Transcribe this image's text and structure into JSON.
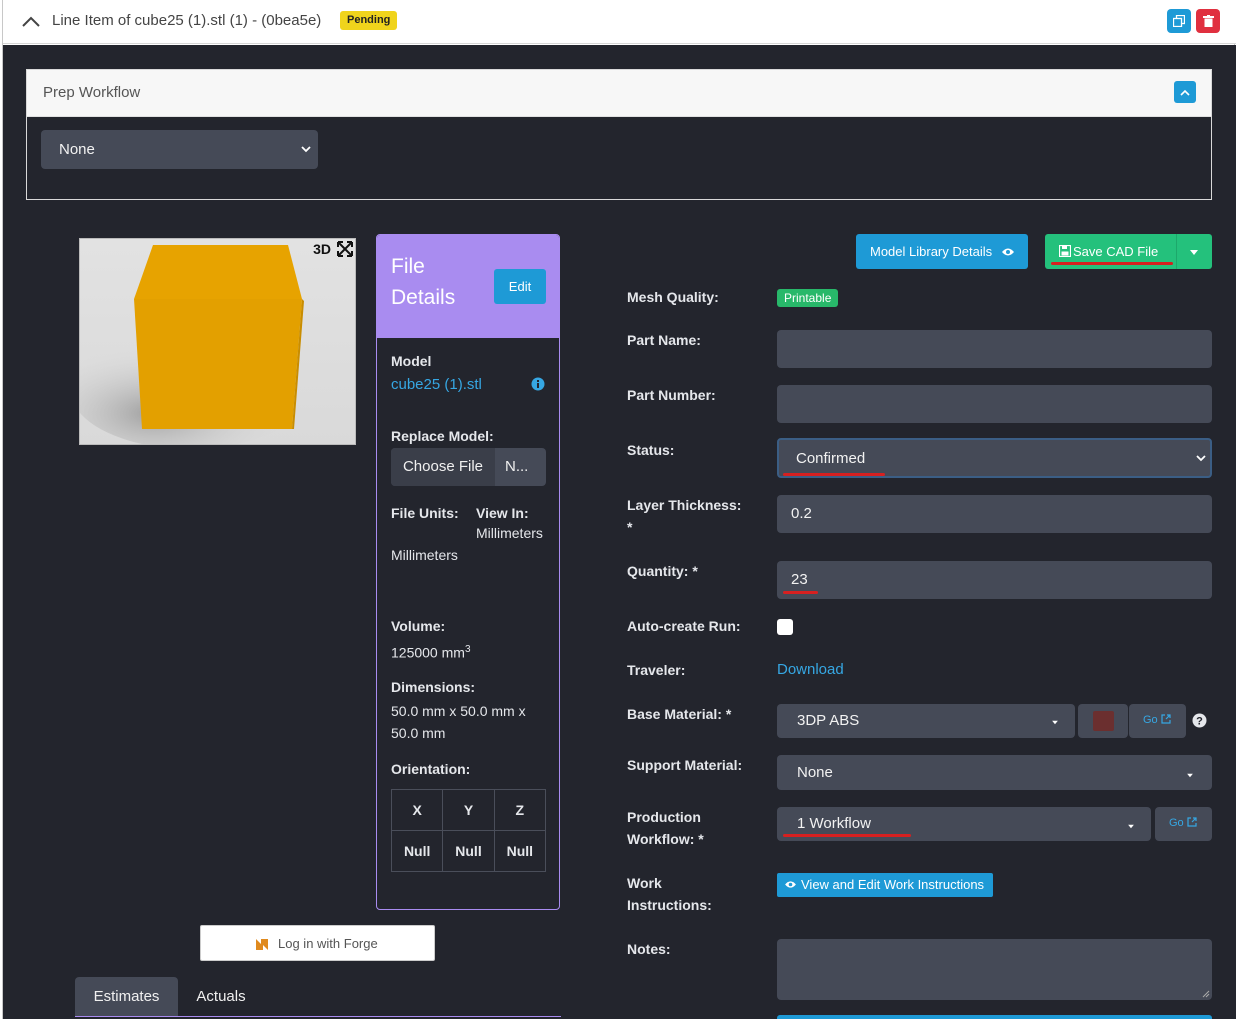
{
  "header": {
    "title": "Line Item of cube25 (1).stl (1) - (0bea5e)",
    "status_badge": "Pending"
  },
  "prep_workflow": {
    "title": "Prep Workflow",
    "selected": "None"
  },
  "preview": {
    "badge": "3D"
  },
  "file_details": {
    "title": "File Details",
    "edit_label": "Edit",
    "model_label": "Model",
    "model_link": "cube25 (1).stl",
    "replace_label": "Replace Model:",
    "choose_file_label": "Choose File",
    "file_name_placeholder": "N...",
    "file_units_label": "File Units:",
    "file_units_value": "Millimeters",
    "view_in_label": "View In:",
    "view_in_value": "Millimeters",
    "volume_label": "Volume:",
    "volume_value": "125000 mm",
    "volume_exp": "3",
    "dimensions_label": "Dimensions:",
    "dimensions_value": "50.0 mm x 50.0 mm x 50.0 mm",
    "orientation_label": "Orientation:",
    "orientation": {
      "headers": [
        "X",
        "Y",
        "Z"
      ],
      "values": [
        "Null",
        "Null",
        "Null"
      ]
    }
  },
  "forge": {
    "label": "Log in with Forge"
  },
  "tabs": [
    {
      "label": "Estimates",
      "active": true
    },
    {
      "label": "Actuals",
      "active": false
    }
  ],
  "actions": {
    "model_library_label": "Model Library Details",
    "save_cad_label": "Save CAD File"
  },
  "form": {
    "mesh_quality_label": "Mesh Quality:",
    "mesh_quality_value": "Printable",
    "part_name_label": "Part Name:",
    "part_name_value": "",
    "part_number_label": "Part Number:",
    "part_number_value": "",
    "status_label": "Status:",
    "status_value": "Confirmed",
    "layer_thickness_label": "Layer Thickness:",
    "layer_thickness_required": "*",
    "layer_thickness_value": "0.2",
    "quantity_label": "Quantity: *",
    "quantity_value": "23",
    "auto_create_label": "Auto-create Run:",
    "auto_create_checked": false,
    "traveler_label": "Traveler:",
    "traveler_link": "Download",
    "base_material_label": "Base Material: *",
    "base_material_value": "3DP ABS",
    "base_material_color": "#6b2f2f",
    "go_label": "Go",
    "support_material_label": "Support Material:",
    "support_material_value": "None",
    "production_workflow_label_1": "Production",
    "production_workflow_label_2": "Workflow: *",
    "production_workflow_value": "1 Workflow",
    "work_instr_label_1": "Work",
    "work_instr_label_2": "Instructions:",
    "work_instr_button": "View and Edit Work Instructions",
    "notes_label": "Notes:",
    "notes_value": ""
  },
  "colors": {
    "accent_blue": "#1e9ad6",
    "success_green": "#24c17c",
    "danger_red": "#e0303f",
    "purple": "#a98cf0",
    "panel_dark": "#23252d",
    "input_dark": "#454a57"
  }
}
